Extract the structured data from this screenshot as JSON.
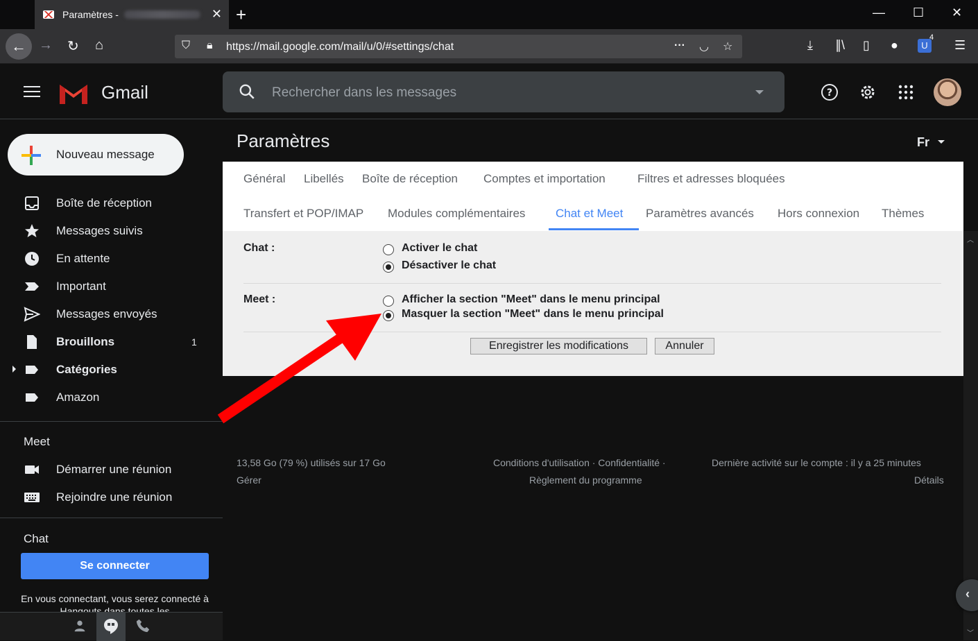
{
  "browser": {
    "tab_title": "Paramètres -",
    "url": "https://mail.google.com/mail/u/0/#settings/chat",
    "badge_count": "4"
  },
  "header": {
    "app_name": "Gmail",
    "search_placeholder": "Rechercher dans les messages"
  },
  "sidebar": {
    "compose_label": "Nouveau message",
    "items": [
      {
        "label": "Boîte de réception",
        "icon": "inbox-icon",
        "bold": false,
        "count": ""
      },
      {
        "label": "Messages suivis",
        "icon": "star-icon",
        "bold": false,
        "count": ""
      },
      {
        "label": "En attente",
        "icon": "clock-icon",
        "bold": false,
        "count": ""
      },
      {
        "label": "Important",
        "icon": "important-icon",
        "bold": false,
        "count": ""
      },
      {
        "label": "Messages envoyés",
        "icon": "send-icon",
        "bold": false,
        "count": ""
      },
      {
        "label": "Brouillons",
        "icon": "draft-icon",
        "bold": true,
        "count": "1"
      },
      {
        "label": "Catégories",
        "icon": "label-icon",
        "bold": true,
        "count": ""
      },
      {
        "label": "Amazon",
        "icon": "label-icon",
        "bold": false,
        "count": ""
      }
    ],
    "meet_title": "Meet",
    "meet_items": [
      {
        "label": "Démarrer une réunion",
        "icon": "video-icon"
      },
      {
        "label": "Rejoindre une réunion",
        "icon": "keyboard-icon"
      }
    ],
    "chat_title": "Chat",
    "connect_label": "Se connecter",
    "connect_note": "En vous connectant, vous serez connecté à Hangouts dans toutes les"
  },
  "settings": {
    "title": "Paramètres",
    "language": "Fr",
    "tabs_row1": [
      "Général",
      "Libellés",
      "Boîte de réception",
      "Comptes et importation",
      "Filtres et adresses bloquées"
    ],
    "tabs_row2": [
      "Transfert et POP/IMAP",
      "Modules complémentaires",
      "Chat et Meet",
      "Paramètres avancés",
      "Hors connexion",
      "Thèmes"
    ],
    "active_tab": "Chat et Meet",
    "chat_label": "Chat :",
    "chat_options": [
      {
        "label": "Activer le chat",
        "checked": false
      },
      {
        "label": "Désactiver le chat",
        "checked": true
      }
    ],
    "meet_label": "Meet :",
    "meet_options": [
      {
        "label": "Afficher la section \"Meet\" dans le menu principal",
        "checked": false
      },
      {
        "label": "Masquer la section \"Meet\" dans le menu principal",
        "checked": true
      }
    ],
    "save_label": "Enregistrer les modifications",
    "cancel_label": "Annuler"
  },
  "footer": {
    "storage": "13,58 Go (79 %) utilisés sur 17 Go",
    "manage": "Gérer",
    "terms": "Conditions d'utilisation · Confidentialité ·",
    "program": "Règlement du programme",
    "activity": "Dernière activité sur le compte : il y a 25 minutes",
    "details": "Détails"
  },
  "colors": {
    "accent": "#4285f4",
    "annotation_arrow": "#ff0000"
  }
}
